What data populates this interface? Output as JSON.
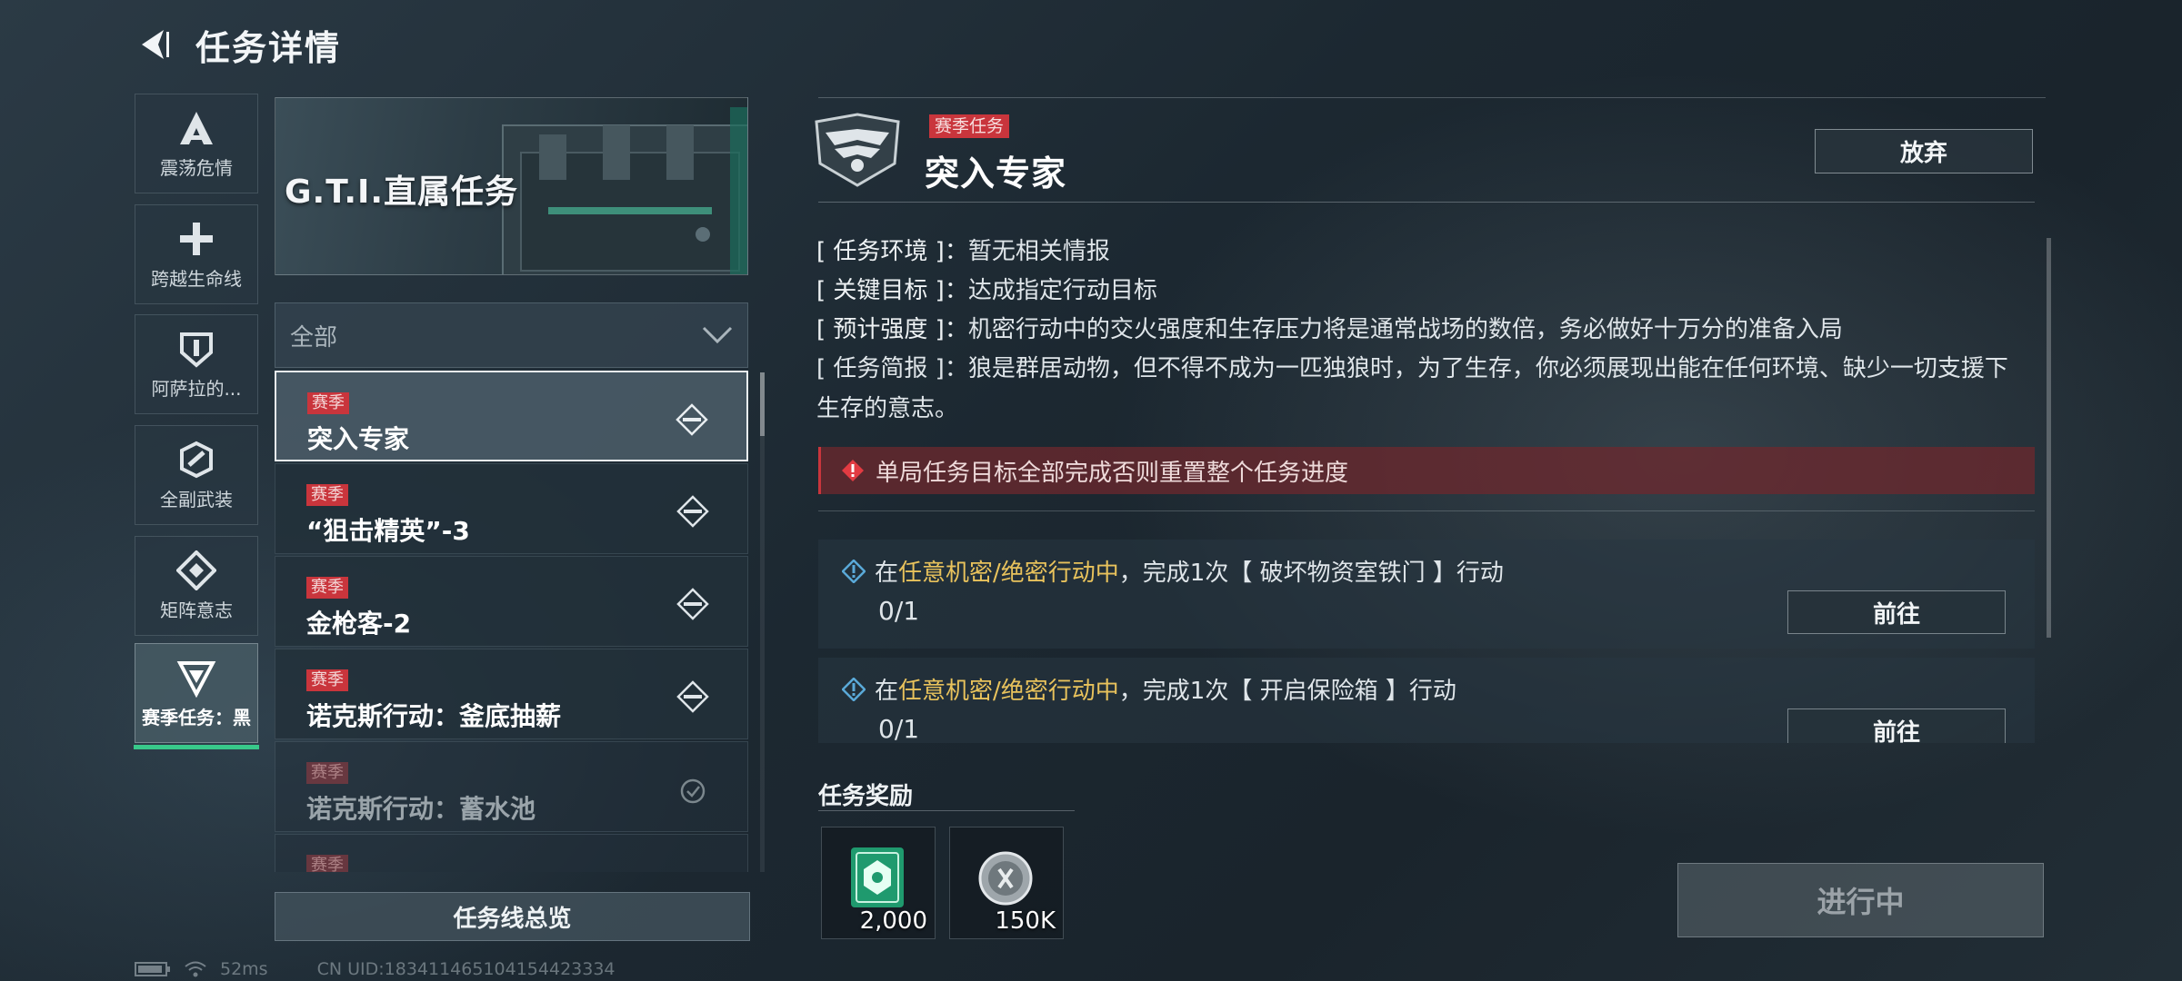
{
  "header": {
    "title": "任务详情"
  },
  "categories": [
    {
      "label": "震荡危情",
      "icon": "a-chevron-icon"
    },
    {
      "label": "跨越生命线",
      "icon": "medical-cross-icon"
    },
    {
      "label": "阿萨拉的...",
      "icon": "shield-icon"
    },
    {
      "label": "全副武装",
      "icon": "armor-icon"
    },
    {
      "label": "矩阵意志",
      "icon": "diamond-icon"
    },
    {
      "label": "赛季任务：黑",
      "icon": "triangle-badge-icon",
      "active": true
    }
  ],
  "banner": {
    "title": "G.T.I.直属任务"
  },
  "filter": {
    "value": "全部"
  },
  "tasks": [
    {
      "tag": "赛季",
      "name": "突入专家",
      "state": "active"
    },
    {
      "tag": "赛季",
      "name": "“狙击精英”-3",
      "state": "open"
    },
    {
      "tag": "赛季",
      "name": "金枪客-2",
      "state": "open"
    },
    {
      "tag": "赛季",
      "name": "诺克斯行动：釜底抽薪",
      "state": "open"
    },
    {
      "tag": "赛季",
      "name": "诺克斯行动：蓄水池",
      "state": "done"
    },
    {
      "tag": "赛季",
      "name": "",
      "state": "done"
    }
  ],
  "overview_button": "任务线总览",
  "status_bar": {
    "ping": "52ms",
    "uid": "CN UID:183411465104154423334"
  },
  "detail": {
    "tag": "赛季任务",
    "title": "突入专家",
    "abandon_label": "放弃",
    "info": {
      "env_key": "[ 任务环境 ]：",
      "env_value": "暂无相关情报",
      "goal_key": "[ 关键目标 ]：",
      "goal_value": "达成指定行动目标",
      "intensity_key": "[ 预计强度 ]：",
      "intensity_value": "机密行动中的交火强度和生存压力将是通常战场的数倍，务必做好十万分的准备入局",
      "brief_key": "[ 任务简报 ]：",
      "brief_value": "狼是群居动物，但不得不成为一匹独狼时，为了生存，你必须展现出能在任何环境、缺少一切支援下生存的意志。"
    },
    "warning": "单局任务目标全部完成否则重置整个任务进度",
    "objectives": [
      {
        "prefix": "在",
        "highlight": "任意机密/绝密行动中",
        "suffix": "，完成1次【 破坏物资室铁门 】行动",
        "progress": "0/1",
        "button": "前往"
      },
      {
        "prefix": "在",
        "highlight": "任意机密/绝密行动中",
        "suffix": "，完成1次【 开启保险箱 】行动",
        "progress": "0/1",
        "button": "前往"
      }
    ],
    "reward_title": "任务奖励",
    "rewards": [
      {
        "count": "2,000",
        "icon": "green-chip-icon"
      },
      {
        "count": "150K",
        "icon": "silver-coin-icon"
      }
    ],
    "status_label": "进行中"
  },
  "colors": {
    "accent_green": "#38c98a",
    "tag_red": "#c9353c",
    "highlight_yellow": "#e8c25c"
  }
}
